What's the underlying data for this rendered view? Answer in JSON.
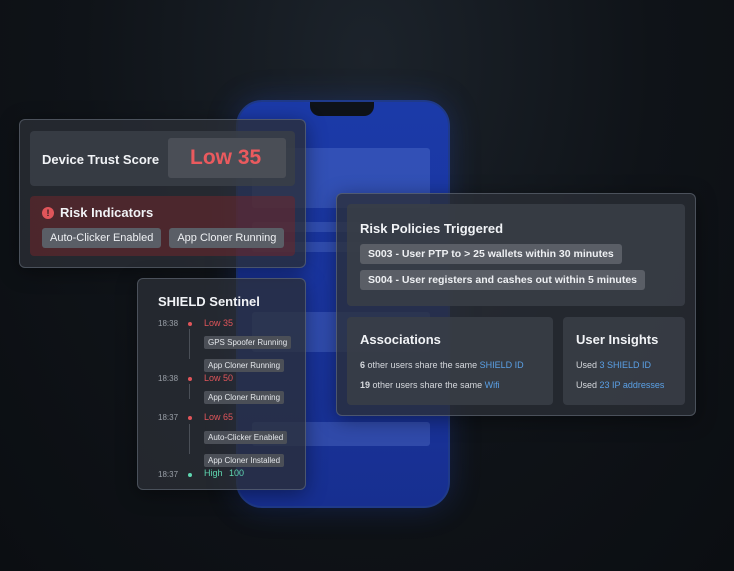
{
  "trust": {
    "title": "Device Trust Score",
    "score": "Low 35"
  },
  "risk": {
    "title": "Risk Indicators",
    "chips": [
      "Auto-Clicker Enabled",
      "App Cloner Running"
    ]
  },
  "policies": {
    "title": "Risk Policies Triggered",
    "items": [
      "S003 - User PTP to > 25 wallets within 30 minutes",
      "S004 - User registers and cashes out within 5 minutes"
    ]
  },
  "associations": {
    "title": "Associations",
    "line1": {
      "count": "6",
      "text": "other users share the same",
      "link": "SHIELD ID"
    },
    "line2": {
      "count": "19",
      "text": "other users share the same",
      "link": "Wifi"
    }
  },
  "insights": {
    "title": "User Insights",
    "line1": {
      "prefix": "Used",
      "link": "3 SHIELD ID"
    },
    "line2": {
      "prefix": "Used",
      "link": "23 IP addresses"
    }
  },
  "sentinel": {
    "title": "SHIELD Sentinel",
    "events": [
      {
        "time": "18:38",
        "label": "Low 35",
        "chips": [
          "GPS Spoofer Running",
          "App Cloner Running"
        ]
      },
      {
        "time": "18:38",
        "label": "Low 50",
        "chips": [
          "App Cloner Running"
        ]
      },
      {
        "time": "18:37",
        "label": "Low 65",
        "chips": [
          "Auto-Clicker Enabled",
          "App Cloner Installed"
        ]
      },
      {
        "time": "18:37",
        "label": "High",
        "score": "100",
        "chips": []
      }
    ]
  },
  "colors": {
    "low": "#e0555a",
    "high": "#5fd6b0",
    "link": "#5aa0e6",
    "phone": "#1b3aa8"
  }
}
